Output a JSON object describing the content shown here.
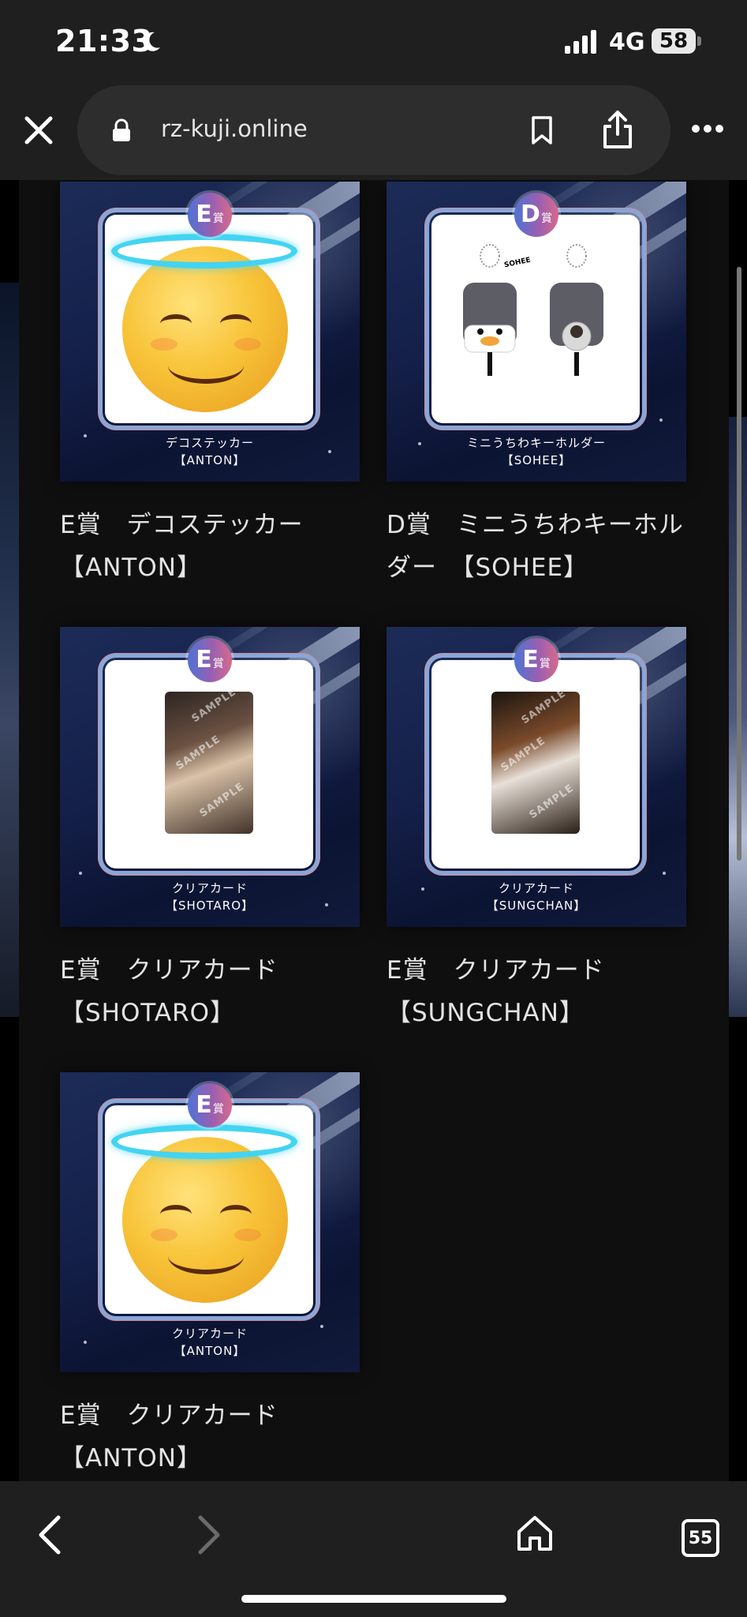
{
  "status_bar": {
    "time": "21:33",
    "network": "4G",
    "battery": "58"
  },
  "browser": {
    "url": "rz-kuji.online",
    "tab_count": "55"
  },
  "products": [
    {
      "grade_letter": "E",
      "grade_suffix": "賞",
      "caption_line1": "デコステッカー",
      "caption_line2": "【ANTON】",
      "title": "E賞　デコステッカー【ANTON】",
      "image": "smiling-halo-emoji"
    },
    {
      "grade_letter": "D",
      "grade_suffix": "賞",
      "caption_line1": "ミニうちわキーホルダー",
      "caption_line2": "【SOHEE】",
      "title": "D賞　ミニうちわキーホルダー　【SOHEE】",
      "image": "mini-fan-keychains",
      "keychain_tag": "SOHEE"
    },
    {
      "grade_letter": "E",
      "grade_suffix": "賞",
      "caption_line1": "クリアカード",
      "caption_line2": "【SHOTARO】",
      "title": "E賞　クリアカード【SHOTARO】",
      "image": "photo-card",
      "watermark": "SAMPLE"
    },
    {
      "grade_letter": "E",
      "grade_suffix": "賞",
      "caption_line1": "クリアカード",
      "caption_line2": "【SUNGCHAN】",
      "title": "E賞　クリアカード【SUNGCHAN】",
      "image": "photo-card",
      "watermark": "SAMPLE"
    },
    {
      "grade_letter": "E",
      "grade_suffix": "賞",
      "caption_line1": "クリアカード",
      "caption_line2": "【ANTON】",
      "title": "E賞　クリアカード【ANTON】",
      "image": "smiling-halo-emoji"
    }
  ],
  "colors": {
    "background": "#0f0f0f",
    "chrome": "#1f1f1f",
    "halo": "#43d4f2",
    "badge_start": "#4d73d6",
    "badge_end": "#d66a8c"
  },
  "icons": {
    "close": "close-icon",
    "lock": "lock-icon",
    "bookmark": "bookmark-icon",
    "share": "share-icon",
    "more": "more-icon",
    "back": "back-arrow-icon",
    "forward": "forward-arrow-icon",
    "home": "home-icon",
    "tabs": "tabs-icon"
  }
}
